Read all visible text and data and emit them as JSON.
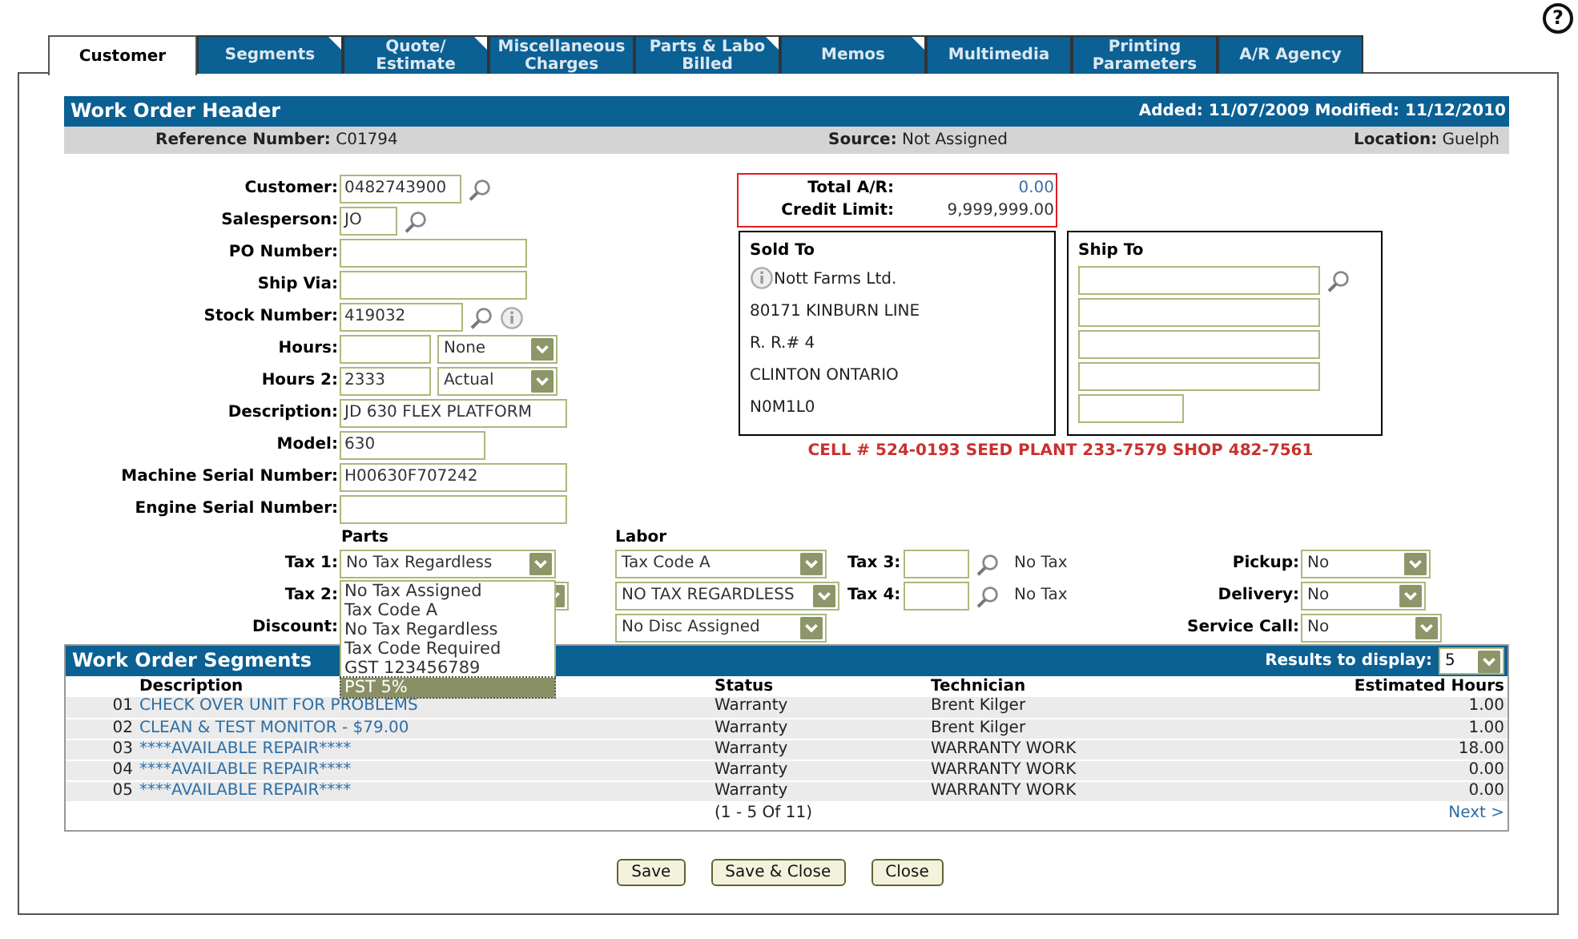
{
  "help": "?",
  "tabs": [
    {
      "lines": [
        "Customer"
      ],
      "selected": true,
      "flagged": false
    },
    {
      "lines": [
        "Segments"
      ],
      "selected": false,
      "flagged": true
    },
    {
      "lines": [
        "Quote/",
        "Estimate"
      ],
      "selected": false,
      "flagged": true
    },
    {
      "lines": [
        "Miscellaneous",
        "Charges"
      ],
      "selected": false,
      "flagged": false
    },
    {
      "lines": [
        "Parts & Labo",
        "Billed"
      ],
      "selected": false,
      "flagged": true
    },
    {
      "lines": [
        "Memos"
      ],
      "selected": false,
      "flagged": true
    },
    {
      "lines": [
        "Multimedia"
      ],
      "selected": false,
      "flagged": false
    },
    {
      "lines": [
        "Printing",
        "Parameters"
      ],
      "selected": false,
      "flagged": false
    },
    {
      "lines": [
        "A/R Agency"
      ],
      "selected": false,
      "flagged": false
    }
  ],
  "header": {
    "title": "Work Order Header",
    "dates": "Added: 11/07/2009 Modified: 11/12/2010"
  },
  "info_bar": [
    {
      "label": "Reference Number:",
      "value": "C01794"
    },
    {
      "label": "Source:",
      "value": "Not Assigned"
    },
    {
      "label": "Location:",
      "value": "Guelph"
    }
  ],
  "fields": [
    {
      "label": "Customer:",
      "value": "0482743900",
      "lookup": true,
      "info": false
    },
    {
      "label": "Salesperson:",
      "value": "JO",
      "lookup": true,
      "info": false
    },
    {
      "label": "PO Number:",
      "lookup": false,
      "info": false
    },
    {
      "label": "Ship Via:",
      "lookup": false,
      "info": false
    },
    {
      "label": "Stock Number:",
      "value": "419032",
      "lookup": true,
      "info": true
    },
    {
      "label": "Hours:",
      "select": "None",
      "lookup": false,
      "info": false
    },
    {
      "label": "Hours 2:",
      "value": "2333",
      "select": "Actual",
      "lookup": false,
      "info": false
    },
    {
      "label": "Description:",
      "value": "JD 630 FLEX PLATFORM",
      "lookup": false,
      "info": false
    },
    {
      "label": "Model:",
      "value": "630",
      "lookup": false,
      "info": false
    },
    {
      "label": "Machine Serial Number:",
      "value": "H00630F707242",
      "lookup": false,
      "info": false
    },
    {
      "label": "Engine Serial Number:",
      "lookup": false,
      "info": false
    }
  ],
  "account": {
    "total_label": "Total A/R:",
    "total": "0.00",
    "credit_label": "Credit Limit:",
    "credit": "9,999,999.00"
  },
  "sold_to": {
    "title": "Sold To",
    "lines": [
      "Nott Farms Ltd.",
      "80171 KINBURN LINE",
      "R. R.# 4",
      "CLINTON ONTARIO",
      "N0M1L0"
    ]
  },
  "ship_to": {
    "title": "Ship To",
    "fields": [
      {
        "kind": "lookup"
      },
      {
        "kind": "text"
      },
      {
        "kind": "text"
      },
      {
        "kind": "text"
      },
      {
        "kind": "short"
      }
    ]
  },
  "note": "CELL # 524-0193 SEED PLANT 233-7579 SHOP 482-7561",
  "tax": {
    "parts_heading": "Parts",
    "labor_heading": "Labor",
    "rows": [
      {
        "label": "Tax 1:",
        "parts": "No Tax Regardless",
        "parts_covered": false,
        "open": true,
        "options": [
          {
            "label": "No Tax Assigned",
            "selected": false
          },
          {
            "label": "Tax Code A",
            "selected": false
          },
          {
            "label": "No Tax Regardless",
            "selected": false
          },
          {
            "label": "Tax Code Required",
            "selected": false
          },
          {
            "label": "GST 123456789",
            "selected": false
          },
          {
            "label": "PST 5%",
            "selected": true
          }
        ],
        "labor": "Tax Code A",
        "extra_label": "Tax 3:",
        "extra_note": "No Tax",
        "option_label": "Pickup:",
        "option": "No"
      },
      {
        "label": "Tax 2:",
        "parts_covered": true,
        "open": false,
        "labor": "NO TAX REGARDLESS",
        "extra_label": "Tax 4:",
        "extra_note": "No Tax",
        "option_label": "Delivery:",
        "option": "No"
      },
      {
        "label": "Discount:",
        "parts_covered": false,
        "open": false,
        "labor": "No Disc Assigned",
        "option_label": "Service Call:",
        "option": "No"
      }
    ]
  },
  "segments": {
    "title": "Work Order Segments",
    "results_label": "Results to display:",
    "results": "5",
    "columns": [
      "Description",
      "Status",
      "Technician",
      "Estimated Hours"
    ],
    "rows": [
      {
        "number": "01",
        "description": "CHECK OVER UNIT FOR PROBLEMS",
        "status": "Warranty",
        "technician": "Brent Kilger",
        "hours": "1.00"
      },
      {
        "number": "02",
        "description": "CLEAN & TEST MONITOR - $79.00",
        "status": "Warranty",
        "technician": "Brent Kilger",
        "hours": "1.00"
      },
      {
        "number": "03",
        "description": "****AVAILABLE REPAIR****",
        "status": "Warranty",
        "technician": "WARRANTY WORK",
        "hours": "18.00"
      },
      {
        "number": "04",
        "description": "****AVAILABLE REPAIR****",
        "status": "Warranty",
        "technician": "WARRANTY WORK",
        "hours": "0.00"
      },
      {
        "number": "05",
        "description": "****AVAILABLE REPAIR****",
        "status": "Warranty",
        "technician": "WARRANTY WORK",
        "hours": "0.00"
      }
    ],
    "pagination": "(1 - 5 Of 11)",
    "next": "Next >"
  },
  "buttons": [
    "Save",
    "Save & Close",
    "Close"
  ]
}
